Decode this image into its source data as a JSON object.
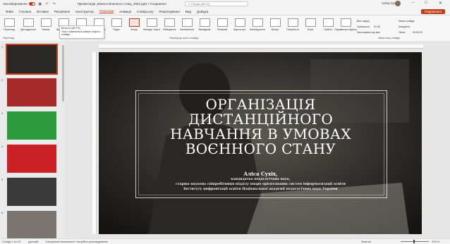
{
  "titlebar": {
    "autosave_label": "Автозбереження",
    "document_title": "Презентація_Вовсно Военного стану_2022.pptx • Сохранено",
    "search_placeholder": "Пошук (Alt+Q)",
    "user_name": "Аліса Сухіх",
    "share_label": "Поділитися"
  },
  "menu": [
    "Файл",
    "Головна",
    "Вставка",
    "Рисування",
    "Конструктор",
    "Переходи",
    "Анімації",
    "Слайд-шоу",
    "Рецензування",
    "Вид",
    "Довідка"
  ],
  "menu_active_index": 5,
  "tooltip": {
    "title": "Витягти (Alt+F5)",
    "text": "Текст з'являється поверх старого слайда"
  },
  "ribbon": {
    "preview_label": "Перегляд",
    "transitions": [
      "Дослідження",
      "Немає",
      "Відомлення",
      "Затухан.",
      "Витіснення",
      "Поділ",
      "Знизу",
      "Випадк. смуги",
      "Обведення",
      "Затемнення",
      "Випадкові",
      "Плавний",
      "Картостул.",
      "Калейдоскоп",
      "Фільтр",
      "Потрапити",
      "Кола",
      "Орбіта"
    ],
    "selected_index": 6,
    "effects_label": "Параметри ефекту",
    "sound_label": "[Без звуку]",
    "duration_label": "Тривалість:",
    "duration_value": "01,40",
    "apply_all_label": "Застосувати до всіх",
    "advance_label": "Зміна слайда",
    "on_click_label": "Клацання",
    "after_label": "Після:",
    "after_value": "00:00,00",
    "group_preview": "Перегляд",
    "group_transition": "Перехід до цього слайда",
    "group_timing": "Зміна часу слайда"
  },
  "slides": [
    {
      "num": "1",
      "color": "#2a2826",
      "selected": true
    },
    {
      "num": "2",
      "color": "#a52a2a",
      "selected": false
    },
    {
      "num": "3",
      "color": "#2e9a3e",
      "selected": false
    },
    {
      "num": "4",
      "color": "#cc2027",
      "selected": false
    },
    {
      "num": "5",
      "color": "#3a3a3a",
      "selected": false
    },
    {
      "num": "6",
      "color": "#7b7570",
      "selected": false
    }
  ],
  "slide_content": {
    "title_lines": [
      "ОРГАНІЗАЦІЯ",
      "ДИСТАНЦІЙНОГО",
      "НАВЧАННЯ В УМОВАХ",
      "ВОЄННОГО СТАНУ"
    ],
    "author": "Аліса Сухіх,",
    "lines": [
      "кандидатка педагогічних наук,",
      "старша наукова співробітниця відділу хмаро орієнтованих систем інформатизації освіти",
      "Інституту цифровізації освіти Національної академії педагогічних наук України"
    ]
  },
  "statusbar": {
    "slide_info": "Слайд 1 из 23",
    "language": "русский",
    "accessibility": "Спеціальні можливості: потрібно розслідування",
    "notes_label": "Замітки",
    "zoom_value": "105 %"
  }
}
